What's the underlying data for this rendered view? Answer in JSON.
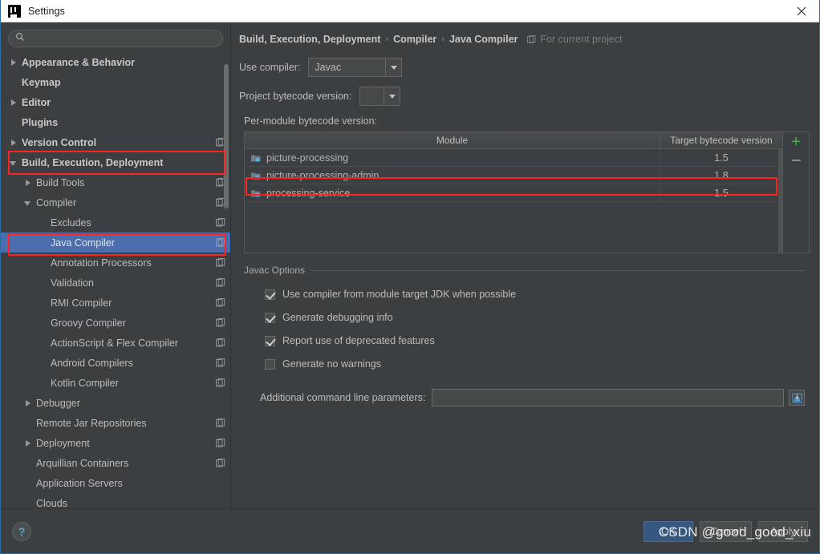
{
  "window": {
    "title": "Settings",
    "logo_icon": "intellij-idea-logo",
    "close_icon": "close-icon"
  },
  "sidebar": {
    "search": {
      "value": "",
      "placeholder": "",
      "icon": "search-icon"
    },
    "items": [
      {
        "label": "Appearance & Behavior",
        "arrow": "right",
        "indent": 0,
        "bold": true,
        "project_icon": false,
        "selected": false
      },
      {
        "label": "Keymap",
        "arrow": "none",
        "indent": 0,
        "bold": true,
        "project_icon": false,
        "selected": false
      },
      {
        "label": "Editor",
        "arrow": "right",
        "indent": 0,
        "bold": true,
        "project_icon": false,
        "selected": false
      },
      {
        "label": "Plugins",
        "arrow": "none",
        "indent": 0,
        "bold": true,
        "project_icon": false,
        "selected": false
      },
      {
        "label": "Version Control",
        "arrow": "right",
        "indent": 0,
        "bold": true,
        "project_icon": true,
        "selected": false
      },
      {
        "label": "Build, Execution, Deployment",
        "arrow": "down",
        "indent": 0,
        "bold": true,
        "project_icon": false,
        "selected": false
      },
      {
        "label": "Build Tools",
        "arrow": "right",
        "indent": 1,
        "bold": false,
        "project_icon": true,
        "selected": false
      },
      {
        "label": "Compiler",
        "arrow": "down",
        "indent": 1,
        "bold": false,
        "project_icon": true,
        "selected": false
      },
      {
        "label": "Excludes",
        "arrow": "none",
        "indent": 2,
        "bold": false,
        "project_icon": true,
        "selected": false
      },
      {
        "label": "Java Compiler",
        "arrow": "none",
        "indent": 2,
        "bold": false,
        "project_icon": true,
        "selected": true
      },
      {
        "label": "Annotation Processors",
        "arrow": "none",
        "indent": 2,
        "bold": false,
        "project_icon": true,
        "selected": false
      },
      {
        "label": "Validation",
        "arrow": "none",
        "indent": 2,
        "bold": false,
        "project_icon": true,
        "selected": false
      },
      {
        "label": "RMI Compiler",
        "arrow": "none",
        "indent": 2,
        "bold": false,
        "project_icon": true,
        "selected": false
      },
      {
        "label": "Groovy Compiler",
        "arrow": "none",
        "indent": 2,
        "bold": false,
        "project_icon": true,
        "selected": false
      },
      {
        "label": "ActionScript & Flex Compiler",
        "arrow": "none",
        "indent": 2,
        "bold": false,
        "project_icon": true,
        "selected": false
      },
      {
        "label": "Android Compilers",
        "arrow": "none",
        "indent": 2,
        "bold": false,
        "project_icon": true,
        "selected": false
      },
      {
        "label": "Kotlin Compiler",
        "arrow": "none",
        "indent": 2,
        "bold": false,
        "project_icon": true,
        "selected": false
      },
      {
        "label": "Debugger",
        "arrow": "right",
        "indent": 1,
        "bold": false,
        "project_icon": false,
        "selected": false
      },
      {
        "label": "Remote Jar Repositories",
        "arrow": "none",
        "indent": 1,
        "bold": false,
        "project_icon": true,
        "selected": false
      },
      {
        "label": "Deployment",
        "arrow": "right",
        "indent": 1,
        "bold": false,
        "project_icon": true,
        "selected": false
      },
      {
        "label": "Arquillian Containers",
        "arrow": "none",
        "indent": 1,
        "bold": false,
        "project_icon": true,
        "selected": false
      },
      {
        "label": "Application Servers",
        "arrow": "none",
        "indent": 1,
        "bold": false,
        "project_icon": false,
        "selected": false
      },
      {
        "label": "Clouds",
        "arrow": "none",
        "indent": 1,
        "bold": false,
        "project_icon": false,
        "selected": false
      }
    ]
  },
  "main": {
    "breadcrumb": {
      "part1": "Build, Execution, Deployment",
      "part2": "Compiler",
      "part3": "Java Compiler",
      "separator": "›",
      "scope_label": "For current project",
      "scope_icon": "project-scope-icon"
    },
    "use_compiler": {
      "label": "Use compiler:",
      "value": "Javac"
    },
    "project_bytecode": {
      "label": "Project bytecode version:",
      "value": ""
    },
    "per_module_label": "Per-module bytecode version:",
    "table": {
      "columns": [
        "Module",
        "Target bytecode version"
      ],
      "rows": [
        {
          "module": "picture-processing",
          "target": "1.5",
          "icon": "module-icon",
          "highlighted": false
        },
        {
          "module": "picture-processing-admin",
          "target": "1.8",
          "icon": "module-icon",
          "highlighted": false
        },
        {
          "module": "processing-service",
          "target": "1.5",
          "icon": "module-icon",
          "highlighted": true
        }
      ],
      "add_button": "+",
      "remove_button": "−"
    },
    "javac_options": {
      "title": "Javac Options",
      "checkboxes": [
        {
          "label": "Use compiler from module target JDK when possible",
          "checked": true
        },
        {
          "label": "Generate debugging info",
          "checked": true
        },
        {
          "label": "Report use of deprecated features",
          "checked": true
        },
        {
          "label": "Generate no warnings",
          "checked": false
        }
      ],
      "additional_params": {
        "label": "Additional command line parameters:",
        "value": "",
        "placeholder": "",
        "expand_icon": "expand-field-icon"
      }
    }
  },
  "footer": {
    "help_label": "?",
    "buttons": [
      {
        "label": "OK",
        "primary": true
      },
      {
        "label": "Cancel",
        "primary": false
      },
      {
        "label": "Apply",
        "primary": false
      }
    ],
    "watermark": "CSDN @good_good_xiu"
  },
  "colors": {
    "background": "#3c3f41",
    "selection": "#4b6eaf",
    "annotation": "#ff2020",
    "accent_green": "#4caf50",
    "link_blue": "#57a6d9"
  }
}
